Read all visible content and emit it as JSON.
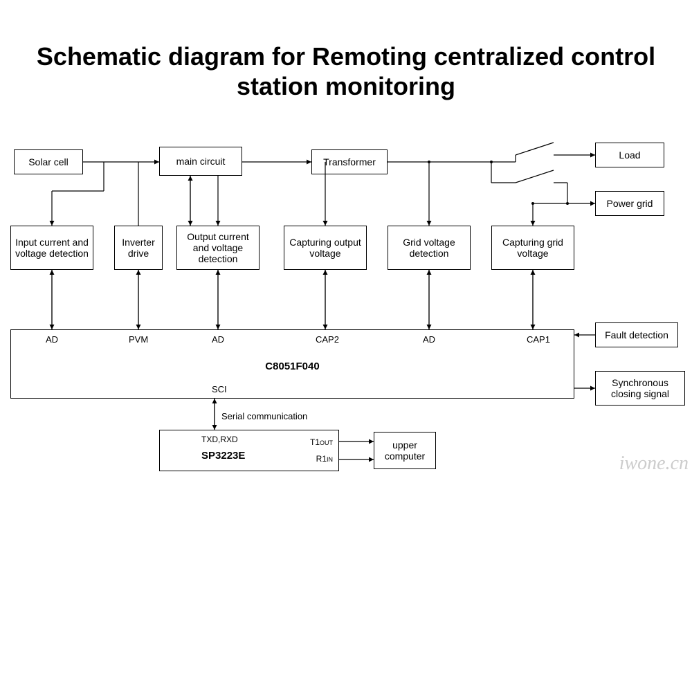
{
  "title": "Schematic diagram for Remoting centralized control station monitoring",
  "blocks": {
    "solar": "Solar cell",
    "main": "main circuit",
    "transformer": "Transformer",
    "load": "Load",
    "powergrid": "Power grid",
    "input_det": "Input current and voltage detection",
    "inverter": "Inverter drive",
    "output_det": "Output current and voltage detection",
    "cap_out": "Capturing output voltage",
    "grid_v": "Grid voltage detection",
    "cap_grid": "Capturing grid voltage",
    "fault": "Fault detection",
    "sync": "Synchronous closing signal",
    "upper": "upper computer"
  },
  "mcu": {
    "name": "C8051F040",
    "ports": {
      "ad1": "AD",
      "pvm": "PVM",
      "ad2": "AD",
      "cap2": "CAP2",
      "ad3": "AD",
      "cap1": "CAP1",
      "sci": "SCI"
    }
  },
  "serial": {
    "comm_label": "Serial communication",
    "chip": "SP3223E",
    "txd": "TXD,RXD",
    "t1": "T1",
    "t1sub": "OUT",
    "r1": "R1",
    "r1sub": "IN"
  },
  "watermark": "iwone.cn"
}
